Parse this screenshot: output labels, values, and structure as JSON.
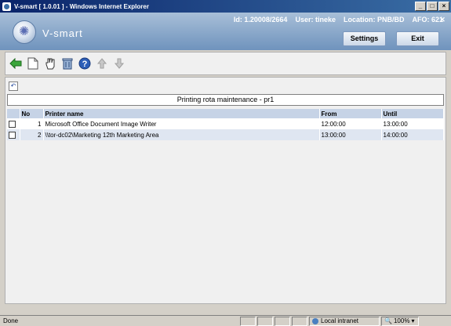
{
  "window": {
    "title": "V-smart [ 1.0.01 ] - Windows Internet Explorer"
  },
  "header": {
    "logo_text": "V-smart",
    "id_text": "Id: 1.20008/2664",
    "user_text": "User: tineke",
    "location_text": "Location: PNB/BD",
    "afo_text": "AFO: 621",
    "settings_label": "Settings",
    "exit_label": "Exit"
  },
  "toolbar": {
    "icons": [
      "back-arrow-icon",
      "new-document-icon",
      "hand-select-icon",
      "trash-icon",
      "help-icon",
      "up-arrow-icon",
      "down-arrow-icon"
    ]
  },
  "main": {
    "title": "Printing rota maintenance - pr1",
    "columns": [
      "No",
      "Printer name",
      "From",
      "Until"
    ],
    "rows": [
      {
        "no": "1",
        "printer": "Microsoft Office Document Image Writer",
        "from": "12:00:00",
        "until": "13:00:00"
      },
      {
        "no": "2",
        "printer": "\\\\tor-dc02\\Marketing 12th Marketing Area",
        "from": "13:00:00",
        "until": "14:00:00"
      }
    ]
  },
  "status": {
    "text": "Done",
    "zone": "Local intranet",
    "zoom": "100%"
  },
  "colors": {
    "title_bar": "#0a246a",
    "header": "#6f93bd",
    "table_header": "#c6d3e6",
    "row_alt": "#dfe6f1"
  }
}
